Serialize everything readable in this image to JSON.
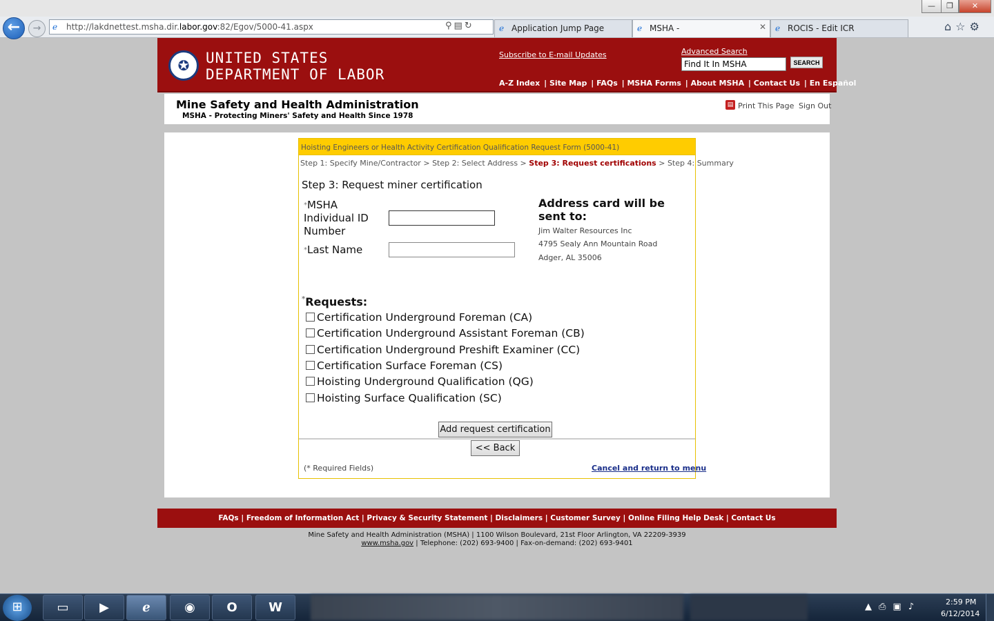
{
  "browser": {
    "address": "http://lakdnettest.msha.dir.labor.gov:82/Egov/5000-41.aspx",
    "tabs": [
      {
        "label": "Application Jump Page"
      },
      {
        "label": "MSHA -"
      },
      {
        "label": "ROCIS - Edit ICR"
      }
    ],
    "window_buttons": {
      "minimize": "—",
      "maximize": "❐",
      "close": "✕"
    }
  },
  "header": {
    "title_line1": "UNITED STATES",
    "title_line2": "DEPARTMENT OF LABOR",
    "subscribe": "Subscribe to E-mail Updates",
    "advanced_search": "Advanced Search",
    "search_value": "Find It In MSHA",
    "search_button": "SEARCH",
    "nav": [
      "A-Z Index",
      "Site Map",
      "FAQs",
      "MSHA Forms",
      "About MSHA",
      "Contact Us",
      "En Español"
    ]
  },
  "subheader": {
    "title": "Mine Safety and Health Administration",
    "tagline": "MSHA - Protecting Miners' Safety and Health Since 1978",
    "print": "Print This Page",
    "signout": "Sign Out"
  },
  "form": {
    "heading": "Hoisting Engineers or Health Activity Certification Qualification Request Form (5000-41)",
    "steps": {
      "s1": "Step 1: Specify Mine/Contractor",
      "s2": "Step 2: Select Address",
      "s3": "Step 3: Request certifications",
      "s4": "Step 4: Summary",
      "sep": ">"
    },
    "step_title": "Step 3: Request miner certification",
    "required_mark": "*",
    "id_label_1": "MSHA",
    "id_label_2": "Individual ID",
    "id_label_3": "Number",
    "lastname_label": "Last Name",
    "address_heading": "Address card will be sent to:",
    "address_lines": [
      "Jim Walter Resources Inc",
      "4795 Sealy Ann Mountain Road",
      "Adger, AL 35006"
    ],
    "requests_label": "Requests:",
    "requests": [
      "Certification Underground Foreman (CA)",
      "Certification Underground Assistant Foreman (CB)",
      "Certification Underground Preshift Examiner (CC)",
      "Certification Surface Foreman (CS)",
      "Hoisting Underground Qualification (QG)",
      "Hoisting Surface Qualification (SC)"
    ],
    "add_button": "Add request certification",
    "back_button": "<< Back",
    "required_fields": "(* Required Fields)",
    "cancel_link": "Cancel and return to menu"
  },
  "footer": {
    "links": [
      "FAQs",
      "Freedom of Information Act",
      "Privacy & Security Statement",
      "Disclaimers",
      "Customer Survey",
      "Online Filing Help Desk",
      "Contact Us"
    ],
    "address_line": "Mine Safety and Health Administration (MSHA) | 1100 Wilson Boulevard, 21st Floor Arlington, VA 22209-3939",
    "website": "www.msha.gov",
    "phone_line": " | Telephone: (202) 693-9400 | Fax-on-demand: (202) 693-9401"
  },
  "taskbar": {
    "time": "2:59 PM",
    "date": "6/12/2014",
    "items": [
      "explorer-icon",
      "media-player-icon",
      "internet-explorer-icon",
      "spotify-icon",
      "outlook-icon",
      "word-icon"
    ]
  }
}
